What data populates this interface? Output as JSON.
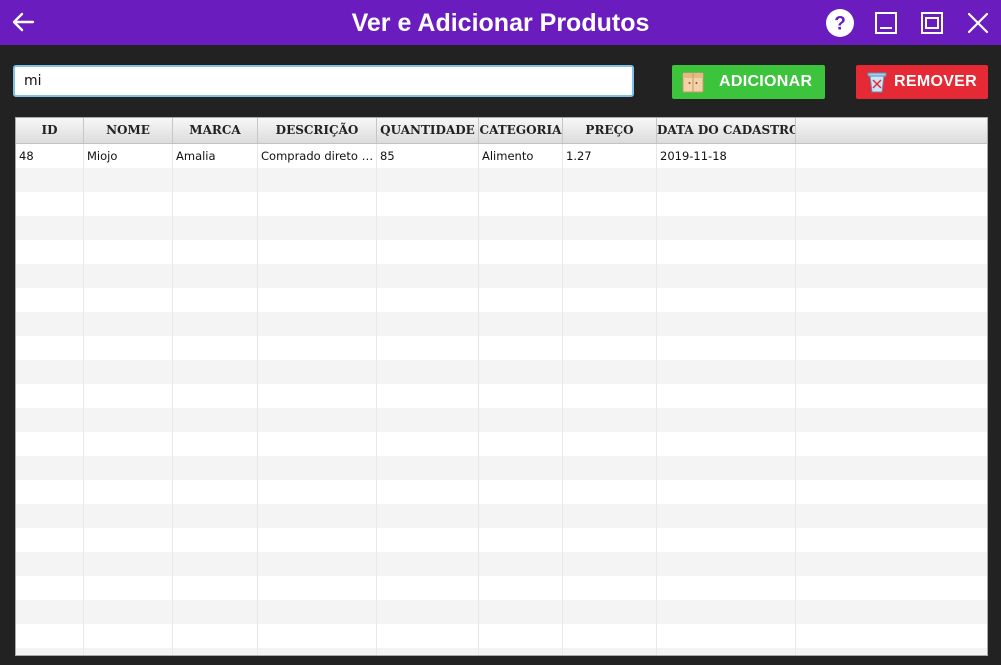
{
  "window": {
    "title": "Ver e Adicionar Produtos"
  },
  "icons": {
    "back": "arrow-left-icon",
    "help": "question-circle-icon",
    "minimize": "minimize-icon",
    "maximize": "maximize-icon",
    "close": "close-icon",
    "add": "box-icon",
    "remove": "trash-icon"
  },
  "search": {
    "value": "mi",
    "placeholder": ""
  },
  "toolbar": {
    "add_label": "ADICIONAR",
    "remove_label": "REMOVER"
  },
  "colors": {
    "titlebar": "#6a1cbf",
    "add": "#3cc43c",
    "remove": "#e52a36",
    "background": "#222222"
  },
  "table": {
    "columns": [
      "ID",
      "NOME",
      "MARCA",
      "DESCRIÇÃO",
      "QUANTIDADE",
      "CATEGORIA",
      "PREÇO",
      "DATA DO CADASTRO",
      ""
    ],
    "rows": [
      [
        "48",
        "Miojo",
        "Amalia",
        "Comprado direto da fábrica",
        "85",
        "Alimento",
        "1.27",
        "2019-11-18",
        ""
      ]
    ]
  }
}
